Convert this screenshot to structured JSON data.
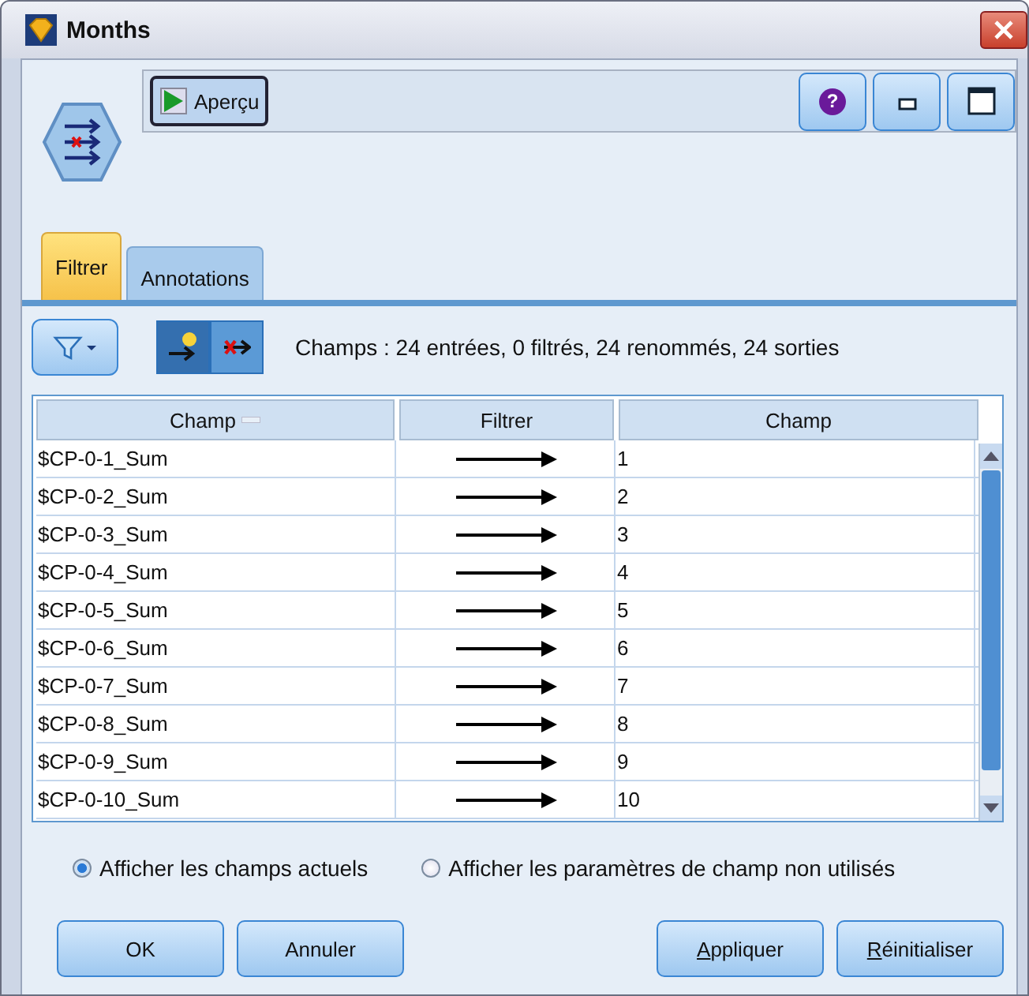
{
  "window": {
    "title": "Months"
  },
  "toolbar": {
    "preview_button": "Aperçu",
    "help_glyph": "?"
  },
  "tabs": [
    {
      "label": "Filtrer",
      "selected": true
    },
    {
      "label": "Annotations",
      "selected": false
    }
  ],
  "summary": "Champs : 24 entrées, 0 filtrés, 24 renommés, 24 sorties",
  "table": {
    "columns": [
      "Champ",
      "Filtrer",
      "Champ"
    ],
    "rows": [
      {
        "field": "$CP-0-1_Sum",
        "filtered": false,
        "new_name": "1"
      },
      {
        "field": "$CP-0-2_Sum",
        "filtered": false,
        "new_name": "2"
      },
      {
        "field": "$CP-0-3_Sum",
        "filtered": false,
        "new_name": "3"
      },
      {
        "field": "$CP-0-4_Sum",
        "filtered": false,
        "new_name": "4"
      },
      {
        "field": "$CP-0-5_Sum",
        "filtered": false,
        "new_name": "5"
      },
      {
        "field": "$CP-0-6_Sum",
        "filtered": false,
        "new_name": "6"
      },
      {
        "field": "$CP-0-7_Sum",
        "filtered": false,
        "new_name": "7"
      },
      {
        "field": "$CP-0-8_Sum",
        "filtered": false,
        "new_name": "8"
      },
      {
        "field": "$CP-0-9_Sum",
        "filtered": false,
        "new_name": "9"
      },
      {
        "field": "$CP-0-10_Sum",
        "filtered": false,
        "new_name": "10"
      }
    ]
  },
  "radios": [
    {
      "label": "Afficher les champs actuels",
      "selected": true
    },
    {
      "label": "Afficher les paramètres de champ non utilisés",
      "selected": false
    }
  ],
  "buttons": {
    "left": [
      "OK",
      "Annuler"
    ],
    "right": [
      "Appliquer",
      "Réinitialiser"
    ]
  }
}
